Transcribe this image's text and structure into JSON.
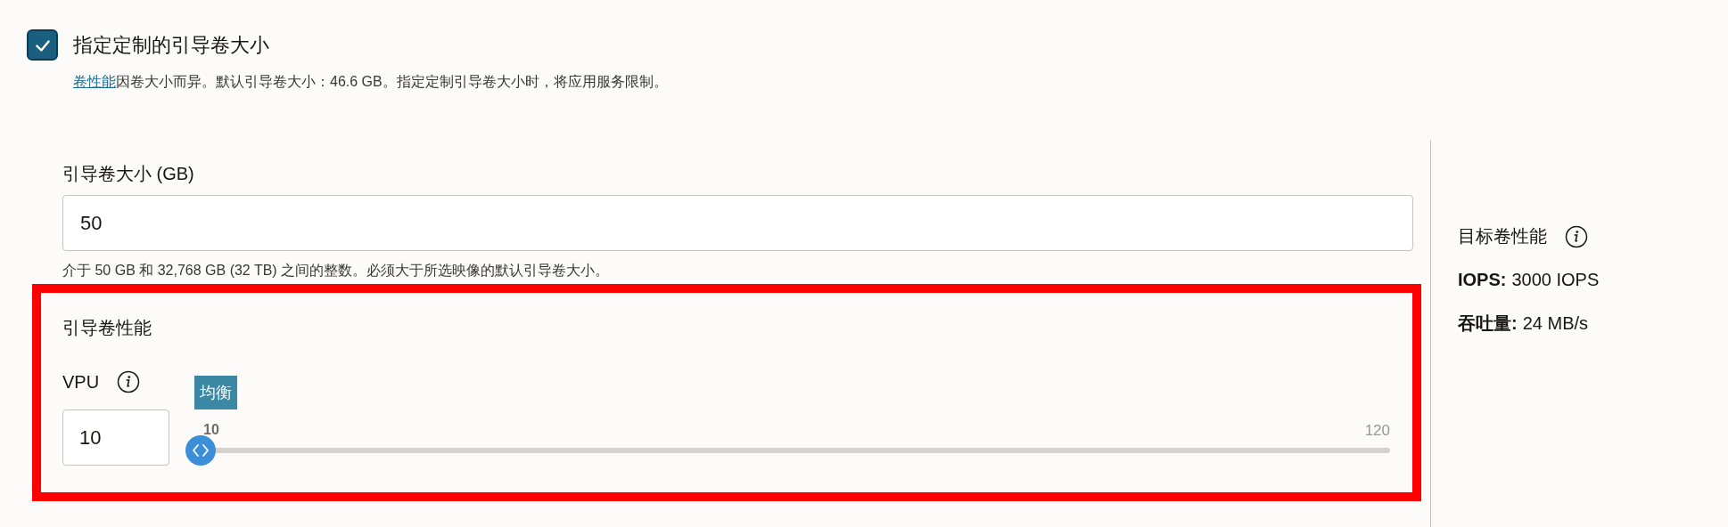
{
  "custom_size": {
    "checked": true,
    "label": "指定定制的引导卷大小",
    "description_link": "卷性能",
    "description": "因卷大小而异。默认引导卷大小：46.6 GB。指定定制引导卷大小时，将应用服务限制。"
  },
  "size_field": {
    "label": "引导卷大小 (GB)",
    "value": "50",
    "help": "介于 50 GB 和 32,768 GB (32 TB) 之间的整数。必须大于所选映像的默认引导卷大小。"
  },
  "performance": {
    "highlighted": true,
    "title": "引导卷性能",
    "vpu_label": "VPU",
    "vpu_value": "10",
    "slider": {
      "level": 0,
      "tooltip": "均衡",
      "value_label": "10",
      "max_label": "120"
    }
  },
  "target": {
    "title": "目标卷性能",
    "metrics": [
      {
        "name": "IOPS:",
        "value": "3000 IOPS"
      },
      {
        "name": "吞吐量:",
        "value": "24 MB/s"
      }
    ]
  }
}
